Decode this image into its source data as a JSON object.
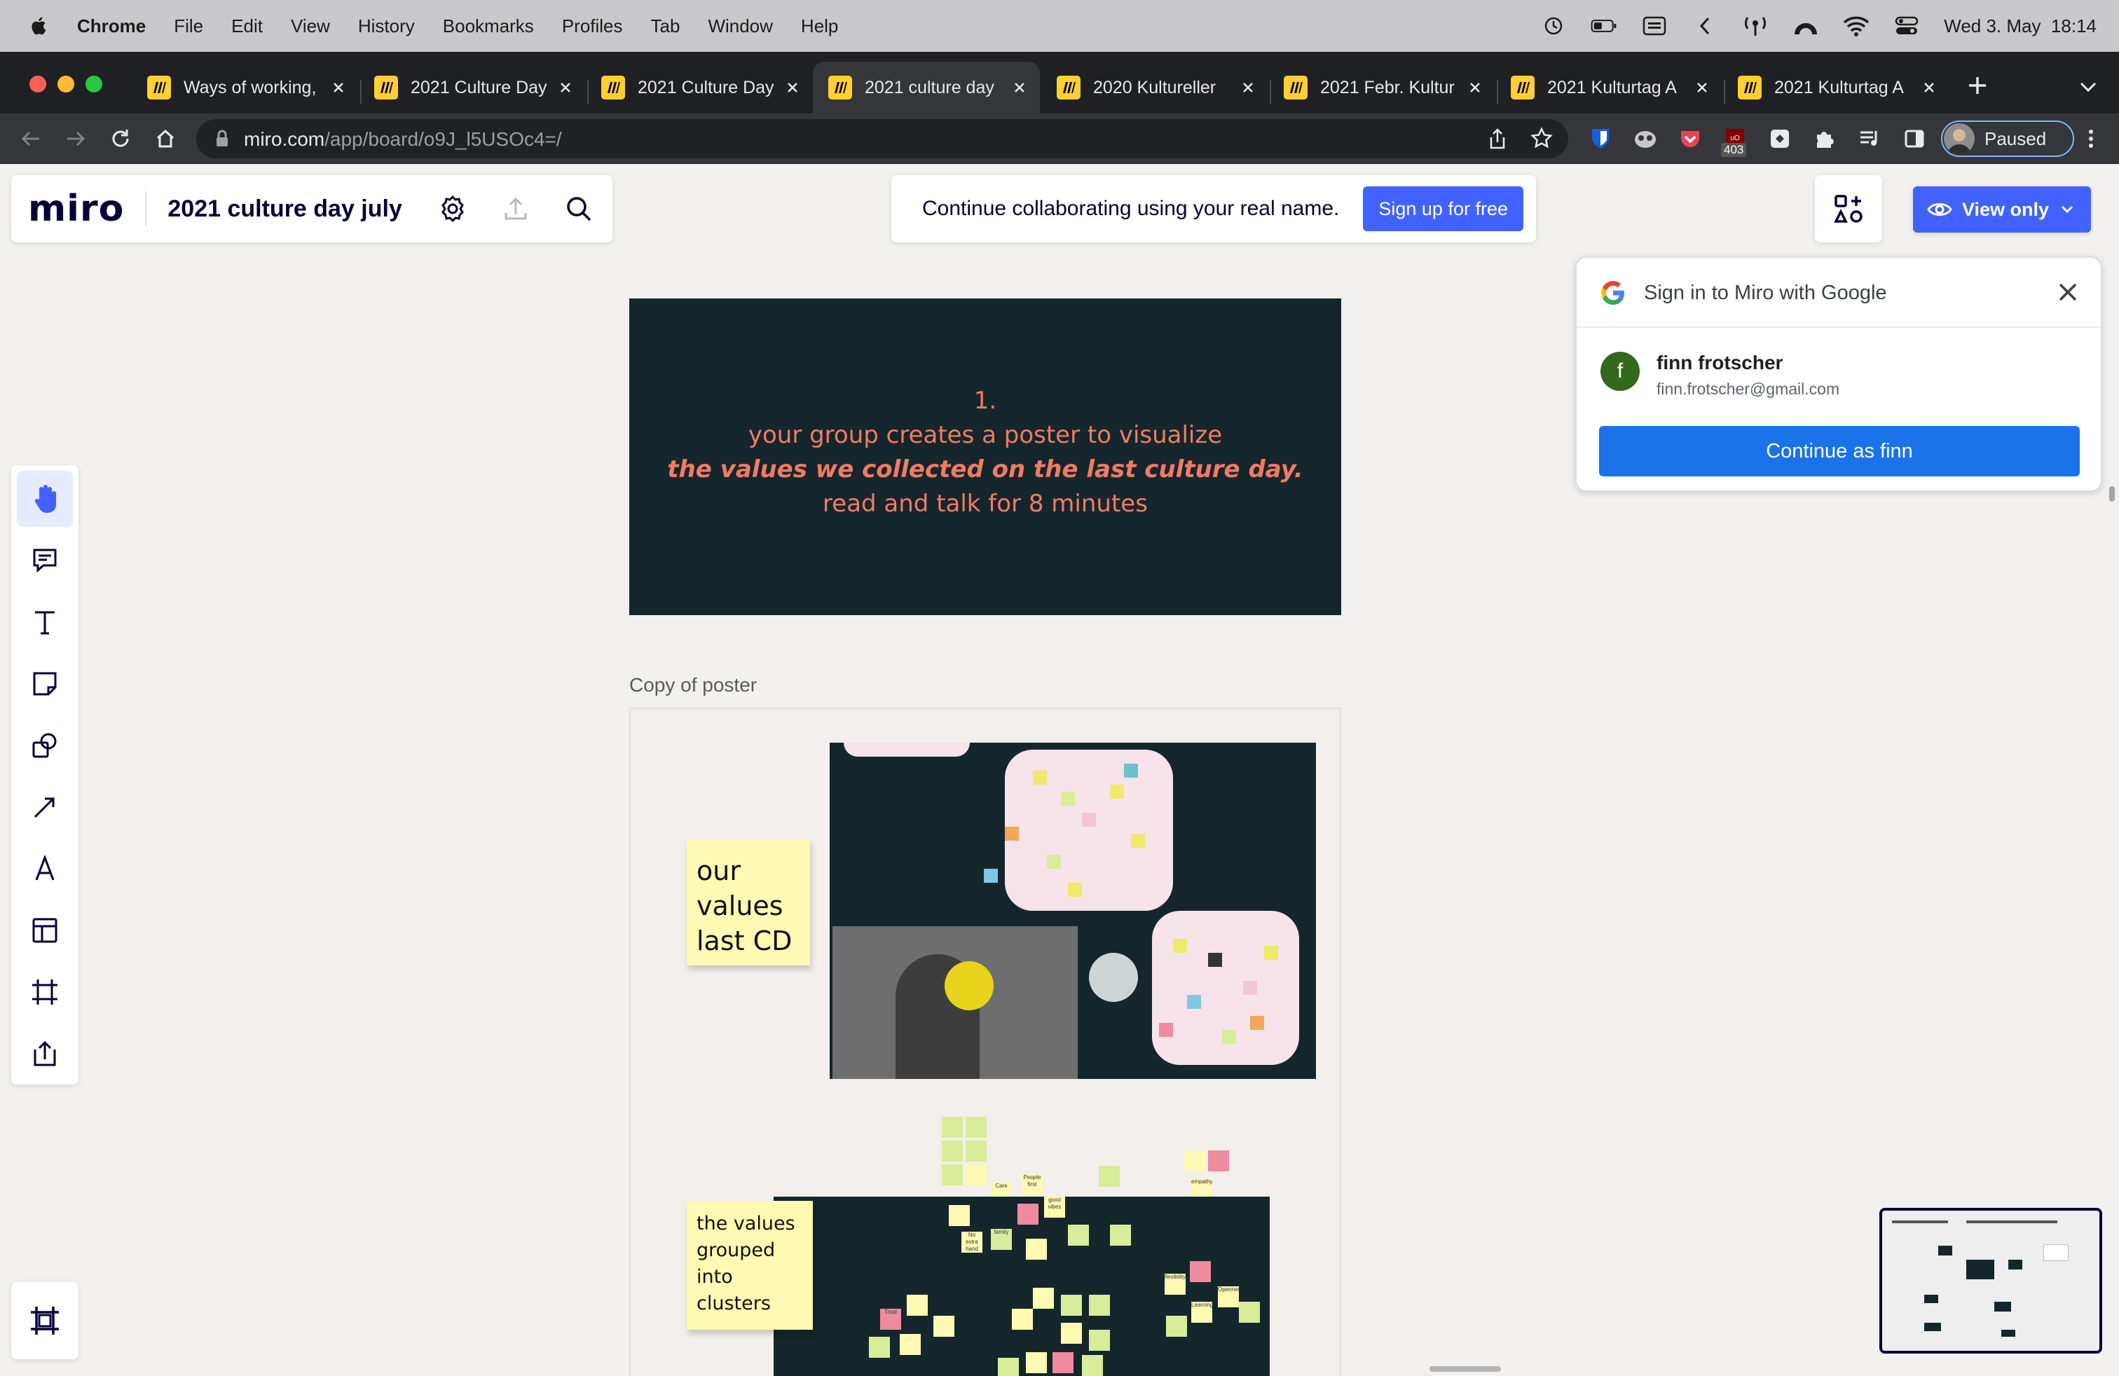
{
  "menubar": {
    "app": "Chrome",
    "items": [
      "File",
      "Edit",
      "View",
      "History",
      "Bookmarks",
      "Profiles",
      "Tab",
      "Window",
      "Help"
    ],
    "clock": "Wed 3. May  18:14"
  },
  "tabs": [
    {
      "title": "Ways of working,"
    },
    {
      "title": "2021 Culture Day"
    },
    {
      "title": "2021 Culture Day"
    },
    {
      "title": "2021 culture day",
      "active": true
    },
    {
      "title": "2020 Kultureller"
    },
    {
      "title": "2021 Febr. Kultur"
    },
    {
      "title": "2021 Kulturtag A"
    },
    {
      "title": "2021 Kulturtag A"
    }
  ],
  "address": {
    "host": "miro.com",
    "path": "/app/board/o9J_l5USOc4=/",
    "badge": "403",
    "profile_status": "Paused"
  },
  "miro": {
    "logo": "miro",
    "board_name": "2021 culture day july",
    "collab_message": "Continue collaborating using your real name.",
    "signup_label": "Sign up for free",
    "view_only_label": "View only"
  },
  "google_popup": {
    "title": "Sign in to Miro with Google",
    "account_initial": "f",
    "account_name": "finn frotscher",
    "account_email": "finn.frotscher@gmail.com",
    "continue_label": "Continue as finn"
  },
  "board": {
    "card_line1": "1.",
    "card_line2": "your group creates a poster to visualize",
    "card_line3": "the values we collected on the last culture day.",
    "card_line4": "read and talk for 8 minutes",
    "frame_label": "Copy of poster",
    "sticky1_lines": [
      "our",
      "values",
      "last CD"
    ],
    "sticky2_lines": [
      "the values",
      "grouped",
      "into",
      "clusters"
    ],
    "poster_notes": [
      "Care",
      "People first",
      "good vibes",
      "No extra hand",
      "family",
      "Trust",
      "empathy",
      "flexibility",
      "Openness",
      "Learning"
    ]
  },
  "colors": {
    "miro_blue": "#4262ff",
    "card_bg": "#14262c",
    "card_text": "#f27a63",
    "sticky_yellow": "#fef9b3",
    "google_blue": "#1a73e8"
  }
}
